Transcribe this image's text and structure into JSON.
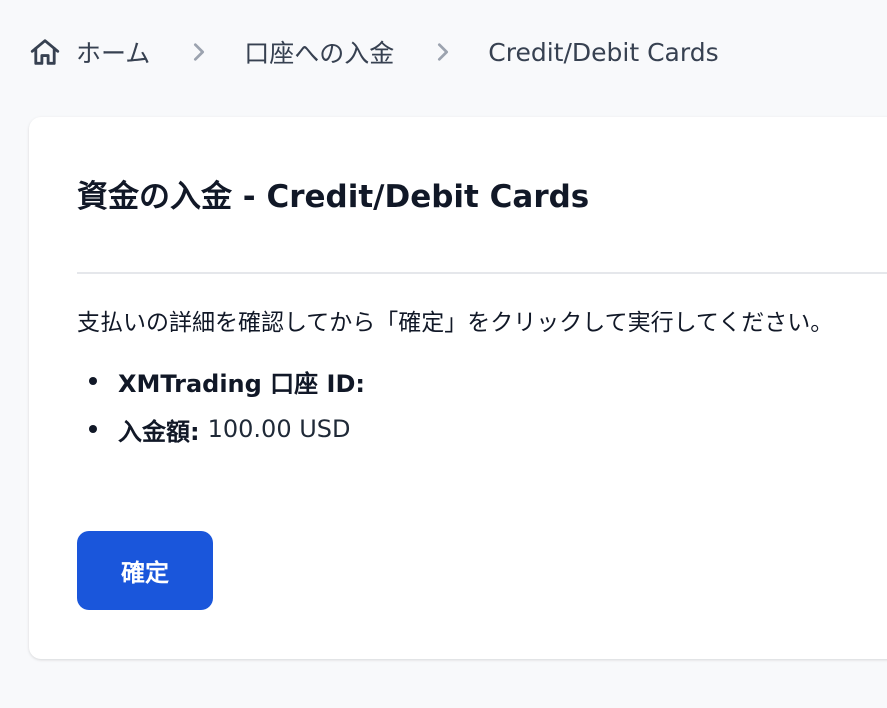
{
  "breadcrumb": {
    "home_label": "ホーム",
    "items": [
      {
        "label": "口座への入金"
      },
      {
        "label": "Credit/Debit Cards"
      }
    ]
  },
  "card": {
    "title": "資金の入金 - Credit/Debit Cards",
    "instruction": "支払いの詳細を確認してから「確定」をクリックして実行してください。",
    "details": [
      {
        "label": "XMTrading 口座 ID:",
        "value": ""
      },
      {
        "label": "入金額:",
        "value": "100.00 USD"
      }
    ],
    "confirm_label": "確定"
  },
  "colors": {
    "primary_button": "#1a56db",
    "background": "#f8f9fb",
    "card": "#ffffff"
  }
}
